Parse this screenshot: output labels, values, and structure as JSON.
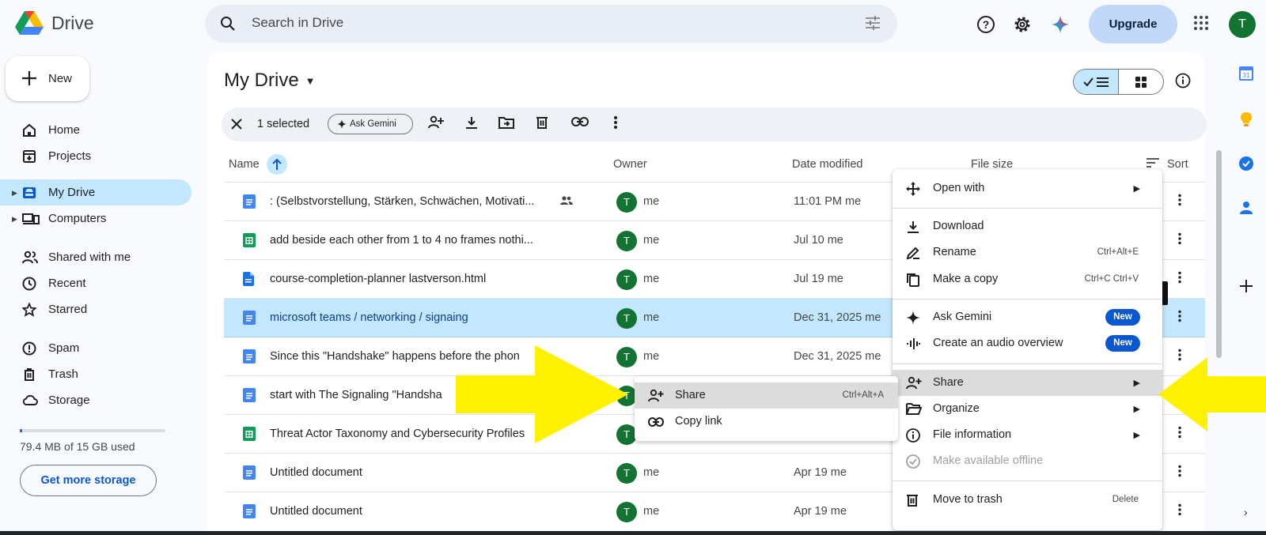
{
  "app": {
    "brand": "Drive"
  },
  "search": {
    "placeholder": "Search in Drive"
  },
  "header": {
    "upgrade_label": "Upgrade",
    "avatar_initial": "T"
  },
  "sidebar": {
    "new_label": "New",
    "items": [
      {
        "label": "Home",
        "icon": "home-icon"
      },
      {
        "label": "Projects",
        "icon": "projects-icon"
      },
      {
        "label": "My Drive",
        "icon": "my-drive-icon",
        "active": true
      },
      {
        "label": "Computers",
        "icon": "computers-icon"
      },
      {
        "label": "Shared with me",
        "icon": "shared-icon"
      },
      {
        "label": "Recent",
        "icon": "recent-icon"
      },
      {
        "label": "Starred",
        "icon": "star-icon"
      },
      {
        "label": "Spam",
        "icon": "spam-icon"
      },
      {
        "label": "Trash",
        "icon": "trash-icon"
      },
      {
        "label": "Storage",
        "icon": "cloud-icon"
      }
    ],
    "storage_text": "79.4 MB of 15 GB used",
    "get_more_storage": "Get more storage"
  },
  "main": {
    "title": "My Drive",
    "selection": {
      "count_label": "1 selected",
      "gemini_chip": "Ask Gemini"
    },
    "columns": {
      "name": "Name",
      "owner": "Owner",
      "date": "Date modified",
      "size": "File size",
      "sort": "Sort"
    },
    "files": [
      {
        "name": ": (Selbstvorstellung, Stärken, Schwächen, Motivati...",
        "type": "doc",
        "owner": "me",
        "date": "11:01 PM me",
        "shared": true
      },
      {
        "name": "add beside each other from 1 to 4 no frames nothi...",
        "type": "sheet",
        "owner": "me",
        "date": "Jul 10 me"
      },
      {
        "name": "course-completion-planner lastverson.html",
        "type": "file",
        "owner": "me",
        "date": "Jul 19 me"
      },
      {
        "name": "microsoft  teams / networking / signaing",
        "type": "doc",
        "owner": "me",
        "date": "Dec 31, 2025 me",
        "selected": true
      },
      {
        "name": "Since this \"Handshake\" happens before the phon",
        "type": "doc",
        "owner": "me",
        "date": "Dec 31, 2025 me"
      },
      {
        "name": "start with The Signaling \"Handsha",
        "type": "doc",
        "owner": "me",
        "date": ""
      },
      {
        "name": "Threat Actor Taxonomy and Cybersecurity Profiles",
        "type": "sheet",
        "owner": "me",
        "date": ""
      },
      {
        "name": "Untitled document",
        "type": "doc",
        "owner": "me",
        "date": "Apr 19 me"
      },
      {
        "name": "Untitled document",
        "type": "doc",
        "owner": "me",
        "date": "Apr 19 me"
      }
    ]
  },
  "context_menu": {
    "open_with": "Open with",
    "download": "Download",
    "rename": "Rename",
    "rename_shortcut": "Ctrl+Alt+E",
    "make_copy": "Make a copy",
    "make_copy_shortcut": "Ctrl+C Ctrl+V",
    "ask_gemini": "Ask Gemini",
    "audio_overview": "Create an audio overview",
    "new_badge": "New",
    "share": "Share",
    "organize": "Organize",
    "file_information": "File information",
    "offline": "Make available offline",
    "move_to_trash": "Move to trash",
    "trash_shortcut": "Delete"
  },
  "share_submenu": {
    "share": "Share",
    "share_shortcut": "Ctrl+Alt+A",
    "copy_link": "Copy link"
  },
  "colors": {
    "accent": "#0b57d0",
    "selection": "#c2e7ff",
    "annotation_arrow": "#fff200",
    "avatar": "#137333"
  }
}
